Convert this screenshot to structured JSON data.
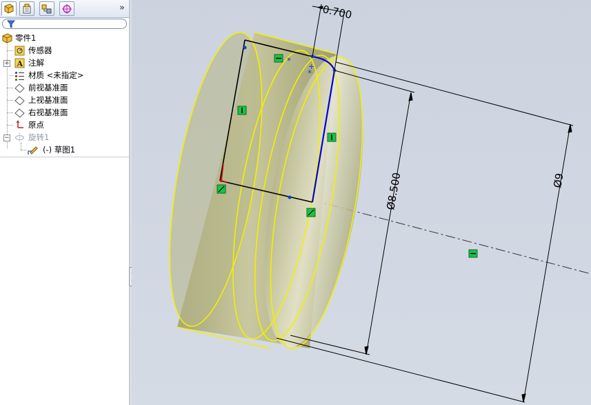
{
  "feature_manager": {
    "tabs": [
      {
        "name": "feature-manager-tab",
        "icon": "feature-tree-icon",
        "active": true
      },
      {
        "name": "property-manager-tab",
        "icon": "property-manager-icon",
        "active": false
      },
      {
        "name": "configuration-manager-tab",
        "icon": "configuration-manager-icon",
        "active": false
      },
      {
        "name": "dimxpert-manager-tab",
        "icon": "dimxpert-icon",
        "active": false
      }
    ],
    "expand_label": "»",
    "filter_icon": "filter-icon",
    "tree": {
      "part": "零件1",
      "sensors": "传感器",
      "annotations": "注解",
      "material": "材质 <未指定>",
      "front_plane": "前视基准面",
      "top_plane": "上视基准面",
      "right_plane": "右视基准面",
      "origin": "原点",
      "revolve": "旋转1",
      "sketch": "(-) 草图1",
      "expand_plus": "+",
      "collapse_minus": "−"
    }
  },
  "splitter": {
    "arrows": "‹‹"
  },
  "graphics": {
    "dimensions": {
      "width": "0.700",
      "inner_diameter": "Ø8.500",
      "outer_diameter": "Ø9"
    },
    "colors": {
      "viewport_bg": "#cfd6e1",
      "part_body": "#c3c29a",
      "silhouette_edge": "#ffff2a",
      "sketch_line": "#000000",
      "selected_line": "#0000e6",
      "relation_marker": "#19c24a"
    }
  }
}
